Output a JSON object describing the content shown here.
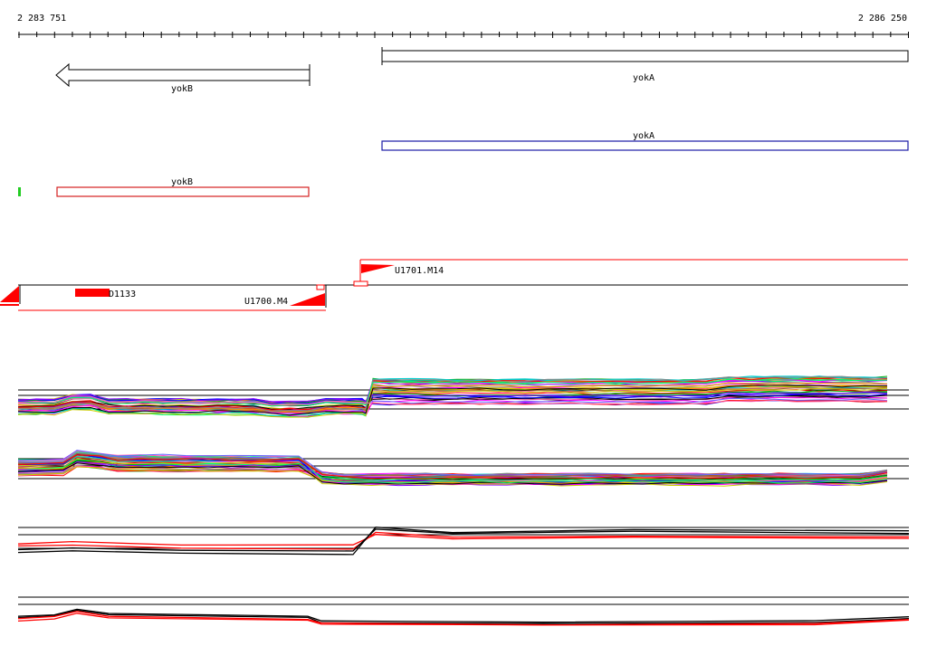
{
  "ruler": {
    "start_label": "2 283 751",
    "end_label": "2 286 250"
  },
  "genes": {
    "yokB_arrow_label": "yokB",
    "yokA_box_label": "yokA",
    "yokA_blue_label": "yokA",
    "yokB_red_label": "yokB"
  },
  "features": {
    "d1133_label": "D1133",
    "u1700_label": "U1700.M4",
    "u1701_label": "U1701.M14"
  },
  "colors": {
    "gene_outline": "#000000",
    "gene_blue": "#1a1aa6",
    "gene_red": "#d42020",
    "marker_green": "#22cc22",
    "feature_red": "#ff0000"
  },
  "tracks": {
    "multicolor_palette": [
      "#ff0000",
      "#00aa00",
      "#0000ff",
      "#ff00ff",
      "#00cccc",
      "#cccc00",
      "#ff8800",
      "#8800ff",
      "#000000",
      "#888888",
      "#00ff66",
      "#ff66aa",
      "#6666ff",
      "#996633"
    ]
  }
}
